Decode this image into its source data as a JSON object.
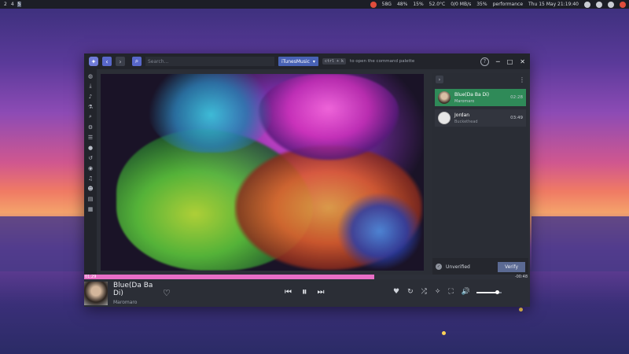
{
  "topbar": {
    "workspaces": [
      "2",
      "4",
      "5"
    ],
    "stats": [
      "58G",
      "48%",
      "15%",
      "52.0°C",
      "0/0 MB/s",
      "35%"
    ],
    "mode": "performance",
    "datetime": "Thu 15 May 21:19:40"
  },
  "app": {
    "search_placeholder": "Search...",
    "source": "iTunesMusic",
    "shortcut_key": "ctrl + k",
    "shortcut_hint": "to open the command palette",
    "help_symbol": "?"
  },
  "queue": {
    "items": [
      {
        "title": "Blue(Da Ba Di)",
        "artist": "Maromaro",
        "duration": "02:28",
        "active": true
      },
      {
        "title": "Jordan",
        "artist": "Buckethead",
        "duration": "03:49",
        "active": false
      }
    ],
    "status": "Unverified",
    "verify_label": "Verify"
  },
  "player": {
    "title": "Blue(Da Ba Di)",
    "artist": "Maromaro",
    "elapsed": "01:29",
    "remaining": "-00:48",
    "progress": 0.65,
    "volume": 0.8
  },
  "colors": {
    "accent": "#5867c9",
    "progress": "#e86fc6",
    "active_queue": "#2f8a58"
  },
  "icons": [
    "gamepad-icon",
    "download-icon",
    "microphone-icon",
    "flask-icon",
    "search-icon",
    "gear-icon",
    "list-icon",
    "drop-icon",
    "history-icon",
    "disc-icon",
    "music-note-icon",
    "user-icon",
    "file-icon",
    "grid-icon"
  ]
}
